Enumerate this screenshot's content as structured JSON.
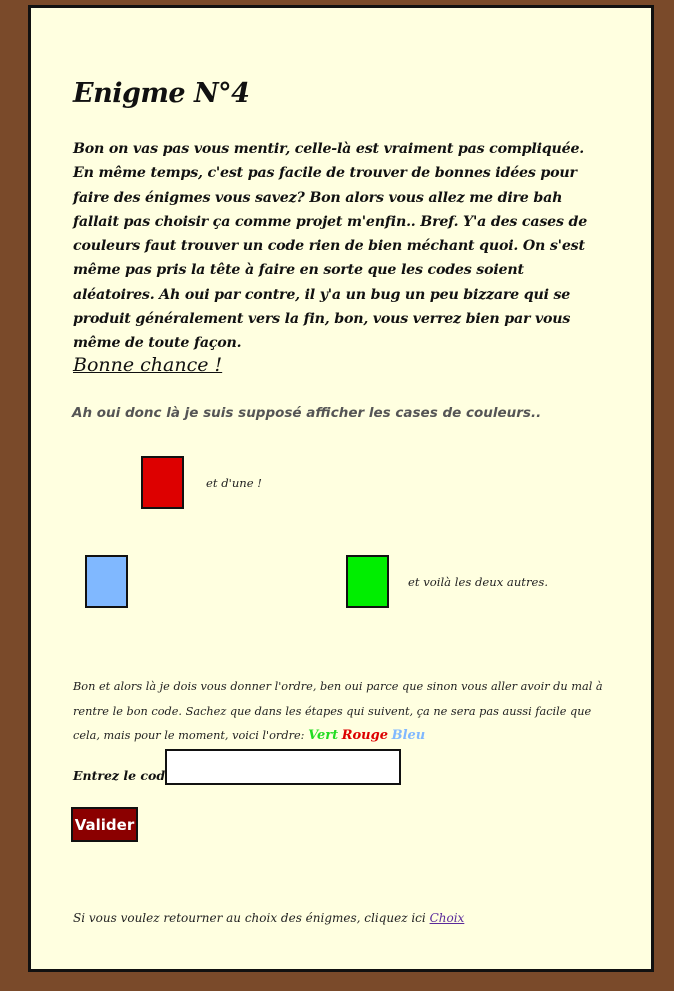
{
  "page": {
    "title": "Enigme N°4",
    "intro": "Bon on vas pas vous mentir, celle-là est vraiment pas compliquée. En même temps, c'est pas facile de trouver de bonnes idées pour faire des énigmes vous savez? Bon alors vous allez me dire bah fallait pas choisir ça comme projet m'enfin.. Bref. Y'a des cases de couleurs faut trouver un code rien de bien méchant quoi. On s'est même pas pris la tête à faire en sorte que les codes soient aléatoires. Ah oui par contre, il y'a un bug un peu bizzare qui se produit généralement vers la fin, bon, vous verrez bien par vous même de toute façon.",
    "good_luck": "Bonne chance !",
    "suppose_text": "Ah oui donc là je suis supposé afficher les cases de couleurs.."
  },
  "boxes": {
    "red_color": "#dd0000",
    "red_note": "et d'une !",
    "blue_color": "#80b8ff",
    "green_color": "#00ee00",
    "green_note": "et voilà les deux autres."
  },
  "order": {
    "text": "Bon et alors là je dois vous donner l'ordre, ben oui parce que sinon vous aller avoir du mal à rentre le bon code. Sachez que dans les étapes qui suivent, ça ne sera pas aussi facile que cela, mais pour le moment, voici l'ordre:",
    "words": [
      {
        "label": "Vert",
        "color": "#22dd22"
      },
      {
        "label": "Rouge",
        "color": "#dd0000"
      },
      {
        "label": "Bleu",
        "color": "#80b8ff"
      }
    ]
  },
  "form": {
    "code_label": "Entrez le code:",
    "code_value": "",
    "submit_label": "Valider"
  },
  "footer": {
    "text": "Si vous voulez retourner au choix des énigmes, cliquez ici",
    "link_label": "Choix"
  }
}
